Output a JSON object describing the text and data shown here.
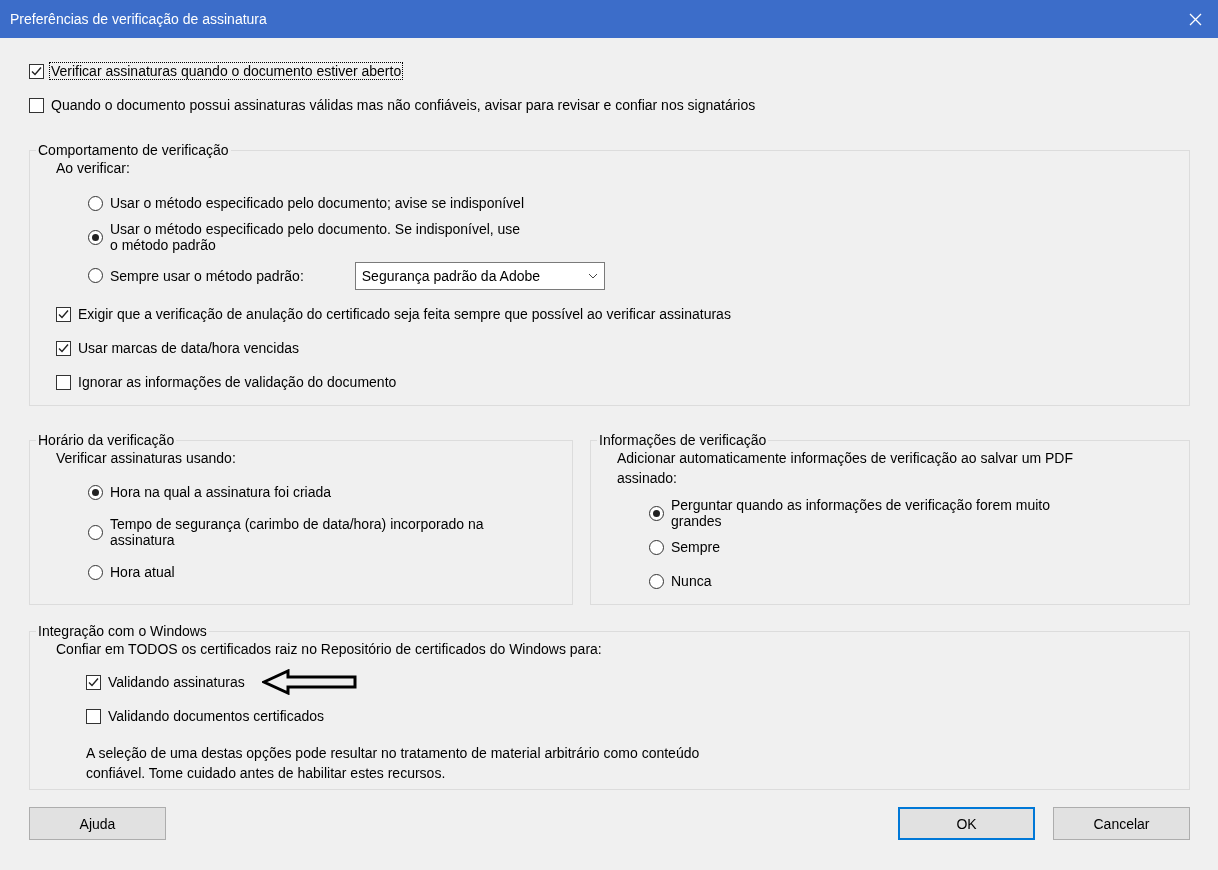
{
  "window": {
    "title": "Preferências de verificação de assinatura"
  },
  "top_checks": [
    {
      "label": "Verificar assinaturas quando o documento estiver aberto",
      "checked": true,
      "focused": true
    },
    {
      "label": "Quando o documento possui assinaturas válidas mas não confiáveis, avisar para revisar e confiar nos signatários",
      "checked": false,
      "focused": false
    }
  ],
  "behavior": {
    "title": "Comportamento de verificação",
    "prompt": "Ao verificar:",
    "options": [
      {
        "kind": "radio",
        "label": "Usar o método especificado pelo documento; avise se indisponível",
        "selected": false
      },
      {
        "kind": "radio",
        "label": "Usar o método especificado pelo documento. Se indisponível, use o método padrão",
        "selected": true
      },
      {
        "kind": "radio-select",
        "label": "Sempre usar o método padrão:",
        "selected": false,
        "select": {
          "value": "Segurança padrão da Adobe"
        }
      }
    ],
    "checks": [
      {
        "label": "Exigir que a verificação de anulação do certificado seja feita sempre que possível ao verificar assinaturas",
        "checked": true
      },
      {
        "label": "Usar marcas de data/hora vencidas",
        "checked": true
      },
      {
        "label": "Ignorar as informações de validação do documento",
        "checked": false
      }
    ]
  },
  "time": {
    "title": "Horário da verificação",
    "prompt": "Verificar assinaturas usando:",
    "options": [
      {
        "label": "Hora na qual a assinatura foi criada",
        "selected": true
      },
      {
        "label": "Tempo de segurança (carimbo de data/hora) incorporado na assinatura",
        "selected": false
      },
      {
        "label": "Hora atual",
        "selected": false
      }
    ]
  },
  "info": {
    "title": "Informações de verificação",
    "prompt": "Adicionar automaticamente informações de verificação ao salvar um PDF assinado:",
    "options": [
      {
        "label": "Perguntar quando as informações de verificação forem muito grandes",
        "selected": true
      },
      {
        "label": "Sempre",
        "selected": false
      },
      {
        "label": "Nunca",
        "selected": false
      }
    ]
  },
  "windows": {
    "title": "Integração com o Windows",
    "prompt": "Confiar em TODOS os certificados raiz no Repositório de certificados do Windows para:",
    "checks": [
      {
        "label": "Validando assinaturas",
        "checked": true,
        "arrow": true
      },
      {
        "label": "Validando documentos certificados",
        "checked": false,
        "arrow": false
      }
    ],
    "note": "A seleção de uma destas opções pode resultar no tratamento de material arbitrário como conteúdo confiável. Tome cuidado antes de habilitar estes recursos."
  },
  "buttons": [
    {
      "label": "Ajuda",
      "kind": "help"
    },
    {
      "label": "OK",
      "kind": "default"
    },
    {
      "label": "Cancelar",
      "kind": "normal"
    }
  ]
}
